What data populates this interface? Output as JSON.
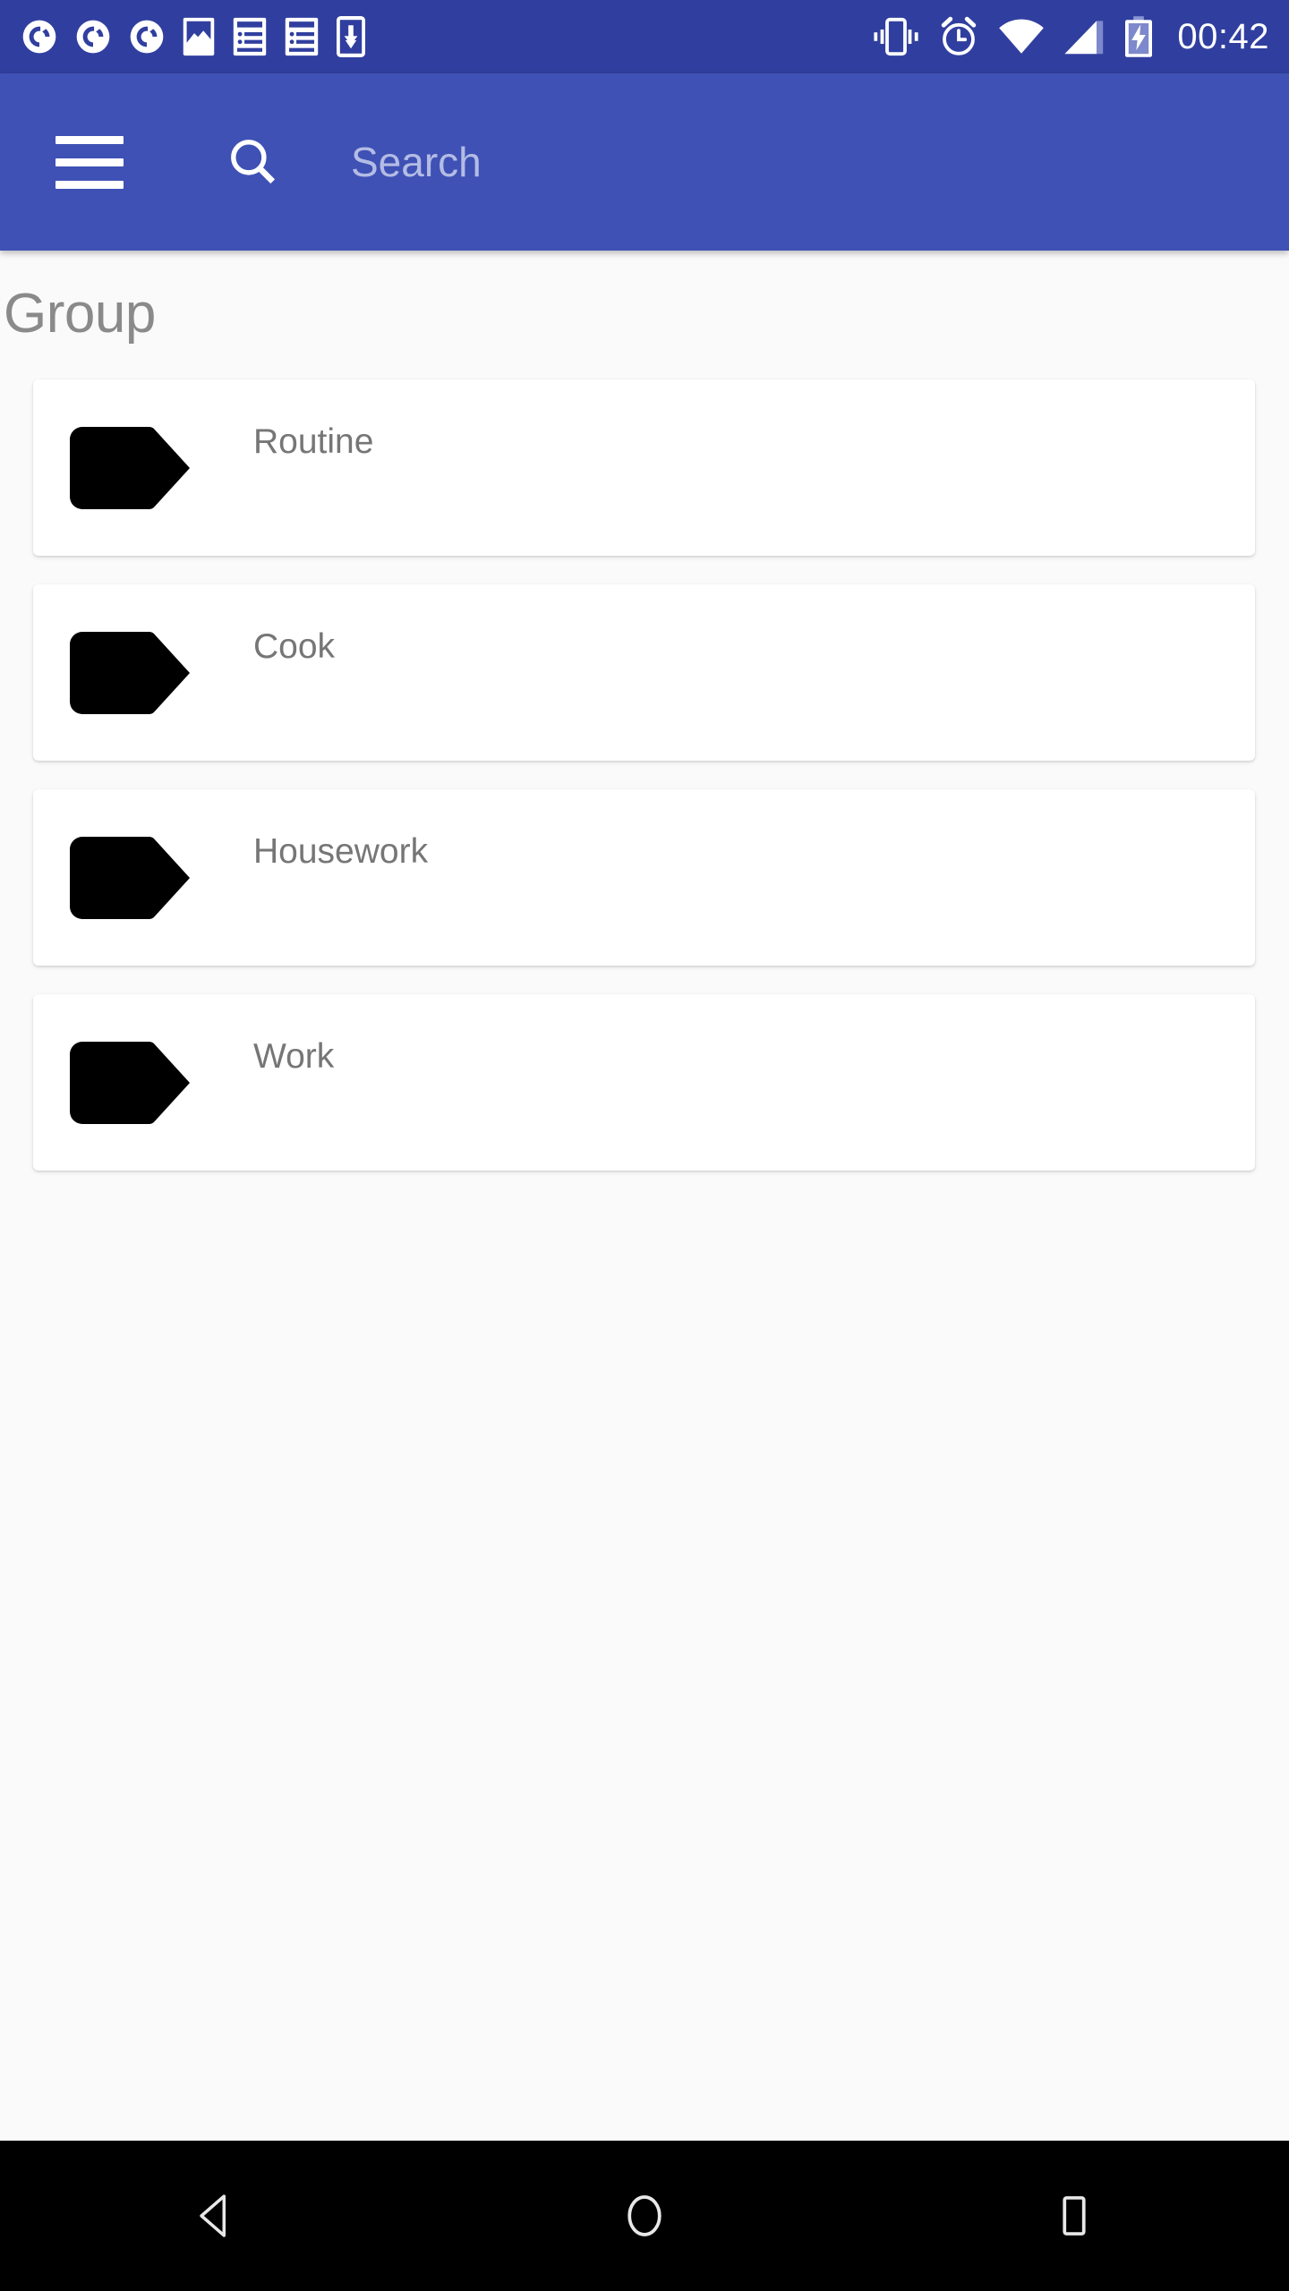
{
  "status_bar": {
    "background": "#303f9f",
    "time": "00:42",
    "left_icons": [
      {
        "name": "sync-circle-icon"
      },
      {
        "name": "sync-circle-icon"
      },
      {
        "name": "sync-circle-icon"
      },
      {
        "name": "image-icon"
      },
      {
        "name": "article-list-icon"
      },
      {
        "name": "article-list-icon"
      },
      {
        "name": "phone-download-icon"
      }
    ],
    "right_icons": [
      {
        "name": "vibrate-icon"
      },
      {
        "name": "alarm-clock-icon"
      },
      {
        "name": "wifi-icon"
      },
      {
        "name": "cellular-signal-icon"
      },
      {
        "name": "battery-charging-icon"
      }
    ]
  },
  "app_bar": {
    "background": "#3f51b5",
    "menu_icon": "hamburger-menu-icon",
    "search_icon": "search-icon",
    "search_value": "",
    "search_placeholder": "Search"
  },
  "main": {
    "section_title": "Group",
    "groups": [
      {
        "label": "Routine",
        "tag_color": "#000000"
      },
      {
        "label": "Cook",
        "tag_color": "#000000"
      },
      {
        "label": "Housework",
        "tag_color": "#000000"
      },
      {
        "label": "Work",
        "tag_color": "#000000"
      }
    ]
  },
  "nav_bar": {
    "background": "#000000",
    "buttons": [
      {
        "name": "back-button",
        "icon": "back-triangle-icon"
      },
      {
        "name": "home-button",
        "icon": "home-circle-icon"
      },
      {
        "name": "recents-button",
        "icon": "recents-square-icon"
      }
    ]
  }
}
